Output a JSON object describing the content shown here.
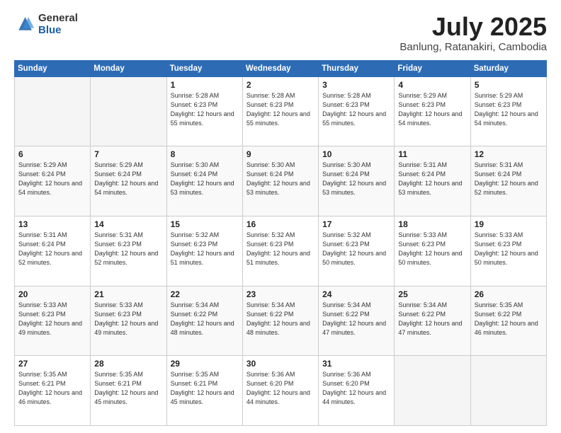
{
  "header": {
    "logo_general": "General",
    "logo_blue": "Blue",
    "month_year": "July 2025",
    "location": "Banlung, Ratanakiri, Cambodia"
  },
  "weekdays": [
    "Sunday",
    "Monday",
    "Tuesday",
    "Wednesday",
    "Thursday",
    "Friday",
    "Saturday"
  ],
  "weeks": [
    [
      {
        "day": "",
        "info": ""
      },
      {
        "day": "",
        "info": ""
      },
      {
        "day": "1",
        "info": "Sunrise: 5:28 AM\nSunset: 6:23 PM\nDaylight: 12 hours\nand 55 minutes."
      },
      {
        "day": "2",
        "info": "Sunrise: 5:28 AM\nSunset: 6:23 PM\nDaylight: 12 hours\nand 55 minutes."
      },
      {
        "day": "3",
        "info": "Sunrise: 5:28 AM\nSunset: 6:23 PM\nDaylight: 12 hours\nand 55 minutes."
      },
      {
        "day": "4",
        "info": "Sunrise: 5:29 AM\nSunset: 6:23 PM\nDaylight: 12 hours\nand 54 minutes."
      },
      {
        "day": "5",
        "info": "Sunrise: 5:29 AM\nSunset: 6:23 PM\nDaylight: 12 hours\nand 54 minutes."
      }
    ],
    [
      {
        "day": "6",
        "info": "Sunrise: 5:29 AM\nSunset: 6:24 PM\nDaylight: 12 hours\nand 54 minutes."
      },
      {
        "day": "7",
        "info": "Sunrise: 5:29 AM\nSunset: 6:24 PM\nDaylight: 12 hours\nand 54 minutes."
      },
      {
        "day": "8",
        "info": "Sunrise: 5:30 AM\nSunset: 6:24 PM\nDaylight: 12 hours\nand 53 minutes."
      },
      {
        "day": "9",
        "info": "Sunrise: 5:30 AM\nSunset: 6:24 PM\nDaylight: 12 hours\nand 53 minutes."
      },
      {
        "day": "10",
        "info": "Sunrise: 5:30 AM\nSunset: 6:24 PM\nDaylight: 12 hours\nand 53 minutes."
      },
      {
        "day": "11",
        "info": "Sunrise: 5:31 AM\nSunset: 6:24 PM\nDaylight: 12 hours\nand 53 minutes."
      },
      {
        "day": "12",
        "info": "Sunrise: 5:31 AM\nSunset: 6:24 PM\nDaylight: 12 hours\nand 52 minutes."
      }
    ],
    [
      {
        "day": "13",
        "info": "Sunrise: 5:31 AM\nSunset: 6:24 PM\nDaylight: 12 hours\nand 52 minutes."
      },
      {
        "day": "14",
        "info": "Sunrise: 5:31 AM\nSunset: 6:23 PM\nDaylight: 12 hours\nand 52 minutes."
      },
      {
        "day": "15",
        "info": "Sunrise: 5:32 AM\nSunset: 6:23 PM\nDaylight: 12 hours\nand 51 minutes."
      },
      {
        "day": "16",
        "info": "Sunrise: 5:32 AM\nSunset: 6:23 PM\nDaylight: 12 hours\nand 51 minutes."
      },
      {
        "day": "17",
        "info": "Sunrise: 5:32 AM\nSunset: 6:23 PM\nDaylight: 12 hours\nand 50 minutes."
      },
      {
        "day": "18",
        "info": "Sunrise: 5:33 AM\nSunset: 6:23 PM\nDaylight: 12 hours\nand 50 minutes."
      },
      {
        "day": "19",
        "info": "Sunrise: 5:33 AM\nSunset: 6:23 PM\nDaylight: 12 hours\nand 50 minutes."
      }
    ],
    [
      {
        "day": "20",
        "info": "Sunrise: 5:33 AM\nSunset: 6:23 PM\nDaylight: 12 hours\nand 49 minutes."
      },
      {
        "day": "21",
        "info": "Sunrise: 5:33 AM\nSunset: 6:23 PM\nDaylight: 12 hours\nand 49 minutes."
      },
      {
        "day": "22",
        "info": "Sunrise: 5:34 AM\nSunset: 6:22 PM\nDaylight: 12 hours\nand 48 minutes."
      },
      {
        "day": "23",
        "info": "Sunrise: 5:34 AM\nSunset: 6:22 PM\nDaylight: 12 hours\nand 48 minutes."
      },
      {
        "day": "24",
        "info": "Sunrise: 5:34 AM\nSunset: 6:22 PM\nDaylight: 12 hours\nand 47 minutes."
      },
      {
        "day": "25",
        "info": "Sunrise: 5:34 AM\nSunset: 6:22 PM\nDaylight: 12 hours\nand 47 minutes."
      },
      {
        "day": "26",
        "info": "Sunrise: 5:35 AM\nSunset: 6:22 PM\nDaylight: 12 hours\nand 46 minutes."
      }
    ],
    [
      {
        "day": "27",
        "info": "Sunrise: 5:35 AM\nSunset: 6:21 PM\nDaylight: 12 hours\nand 46 minutes."
      },
      {
        "day": "28",
        "info": "Sunrise: 5:35 AM\nSunset: 6:21 PM\nDaylight: 12 hours\nand 45 minutes."
      },
      {
        "day": "29",
        "info": "Sunrise: 5:35 AM\nSunset: 6:21 PM\nDaylight: 12 hours\nand 45 minutes."
      },
      {
        "day": "30",
        "info": "Sunrise: 5:36 AM\nSunset: 6:20 PM\nDaylight: 12 hours\nand 44 minutes."
      },
      {
        "day": "31",
        "info": "Sunrise: 5:36 AM\nSunset: 6:20 PM\nDaylight: 12 hours\nand 44 minutes."
      },
      {
        "day": "",
        "info": ""
      },
      {
        "day": "",
        "info": ""
      }
    ]
  ]
}
